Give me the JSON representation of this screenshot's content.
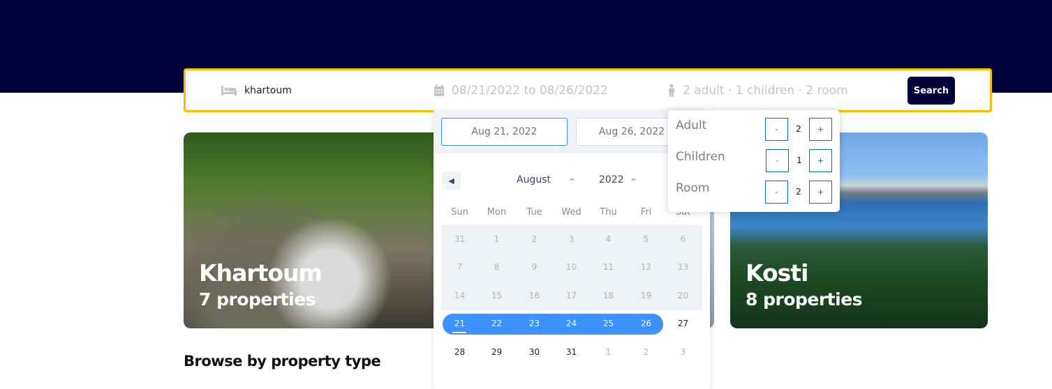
{
  "search": {
    "destination_value": "khartoum",
    "date_text": "08/21/2022 to 08/26/2022",
    "options_text": "2 adult · 1 children · 2 room",
    "search_label": "Search"
  },
  "cards": [
    {
      "title": "Khartoum",
      "subtitle": "7 properties"
    },
    {
      "title": "",
      "subtitle": ""
    },
    {
      "title": "Kosti",
      "subtitle": "8 properties"
    }
  ],
  "section_title": "Browse by property type",
  "datepicker": {
    "start_date": "Aug 21, 2022",
    "end_date": "Aug 26, 2022",
    "month": "August",
    "year": "2022",
    "weekdays": [
      "Sun",
      "Mon",
      "Tue",
      "Wed",
      "Thu",
      "Fri",
      "Sat"
    ],
    "weeks": [
      [
        "31",
        "1",
        "2",
        "3",
        "4",
        "5",
        "6"
      ],
      [
        "7",
        "8",
        "9",
        "10",
        "11",
        "12",
        "13"
      ],
      [
        "14",
        "15",
        "16",
        "17",
        "18",
        "19",
        "20"
      ],
      [
        "21",
        "22",
        "23",
        "24",
        "25",
        "26",
        "27"
      ],
      [
        "28",
        "29",
        "30",
        "31",
        "1",
        "2",
        "3"
      ]
    ],
    "selected_range": [
      "21",
      "26"
    ]
  },
  "options": {
    "adult": {
      "label": "Adult",
      "value": "2"
    },
    "children": {
      "label": "Children",
      "value": "1"
    },
    "room": {
      "label": "Room",
      "value": "2"
    },
    "minus_label": "-",
    "plus_label": "+"
  },
  "colors": {
    "header": "#02013a",
    "accent_border": "#febb02",
    "range": "#3d91ff",
    "counter": "#0071c2"
  },
  "icons": {
    "destination": "bed-icon",
    "date": "calendar-icon",
    "options": "person-icon",
    "prev": "caret-left-icon"
  }
}
